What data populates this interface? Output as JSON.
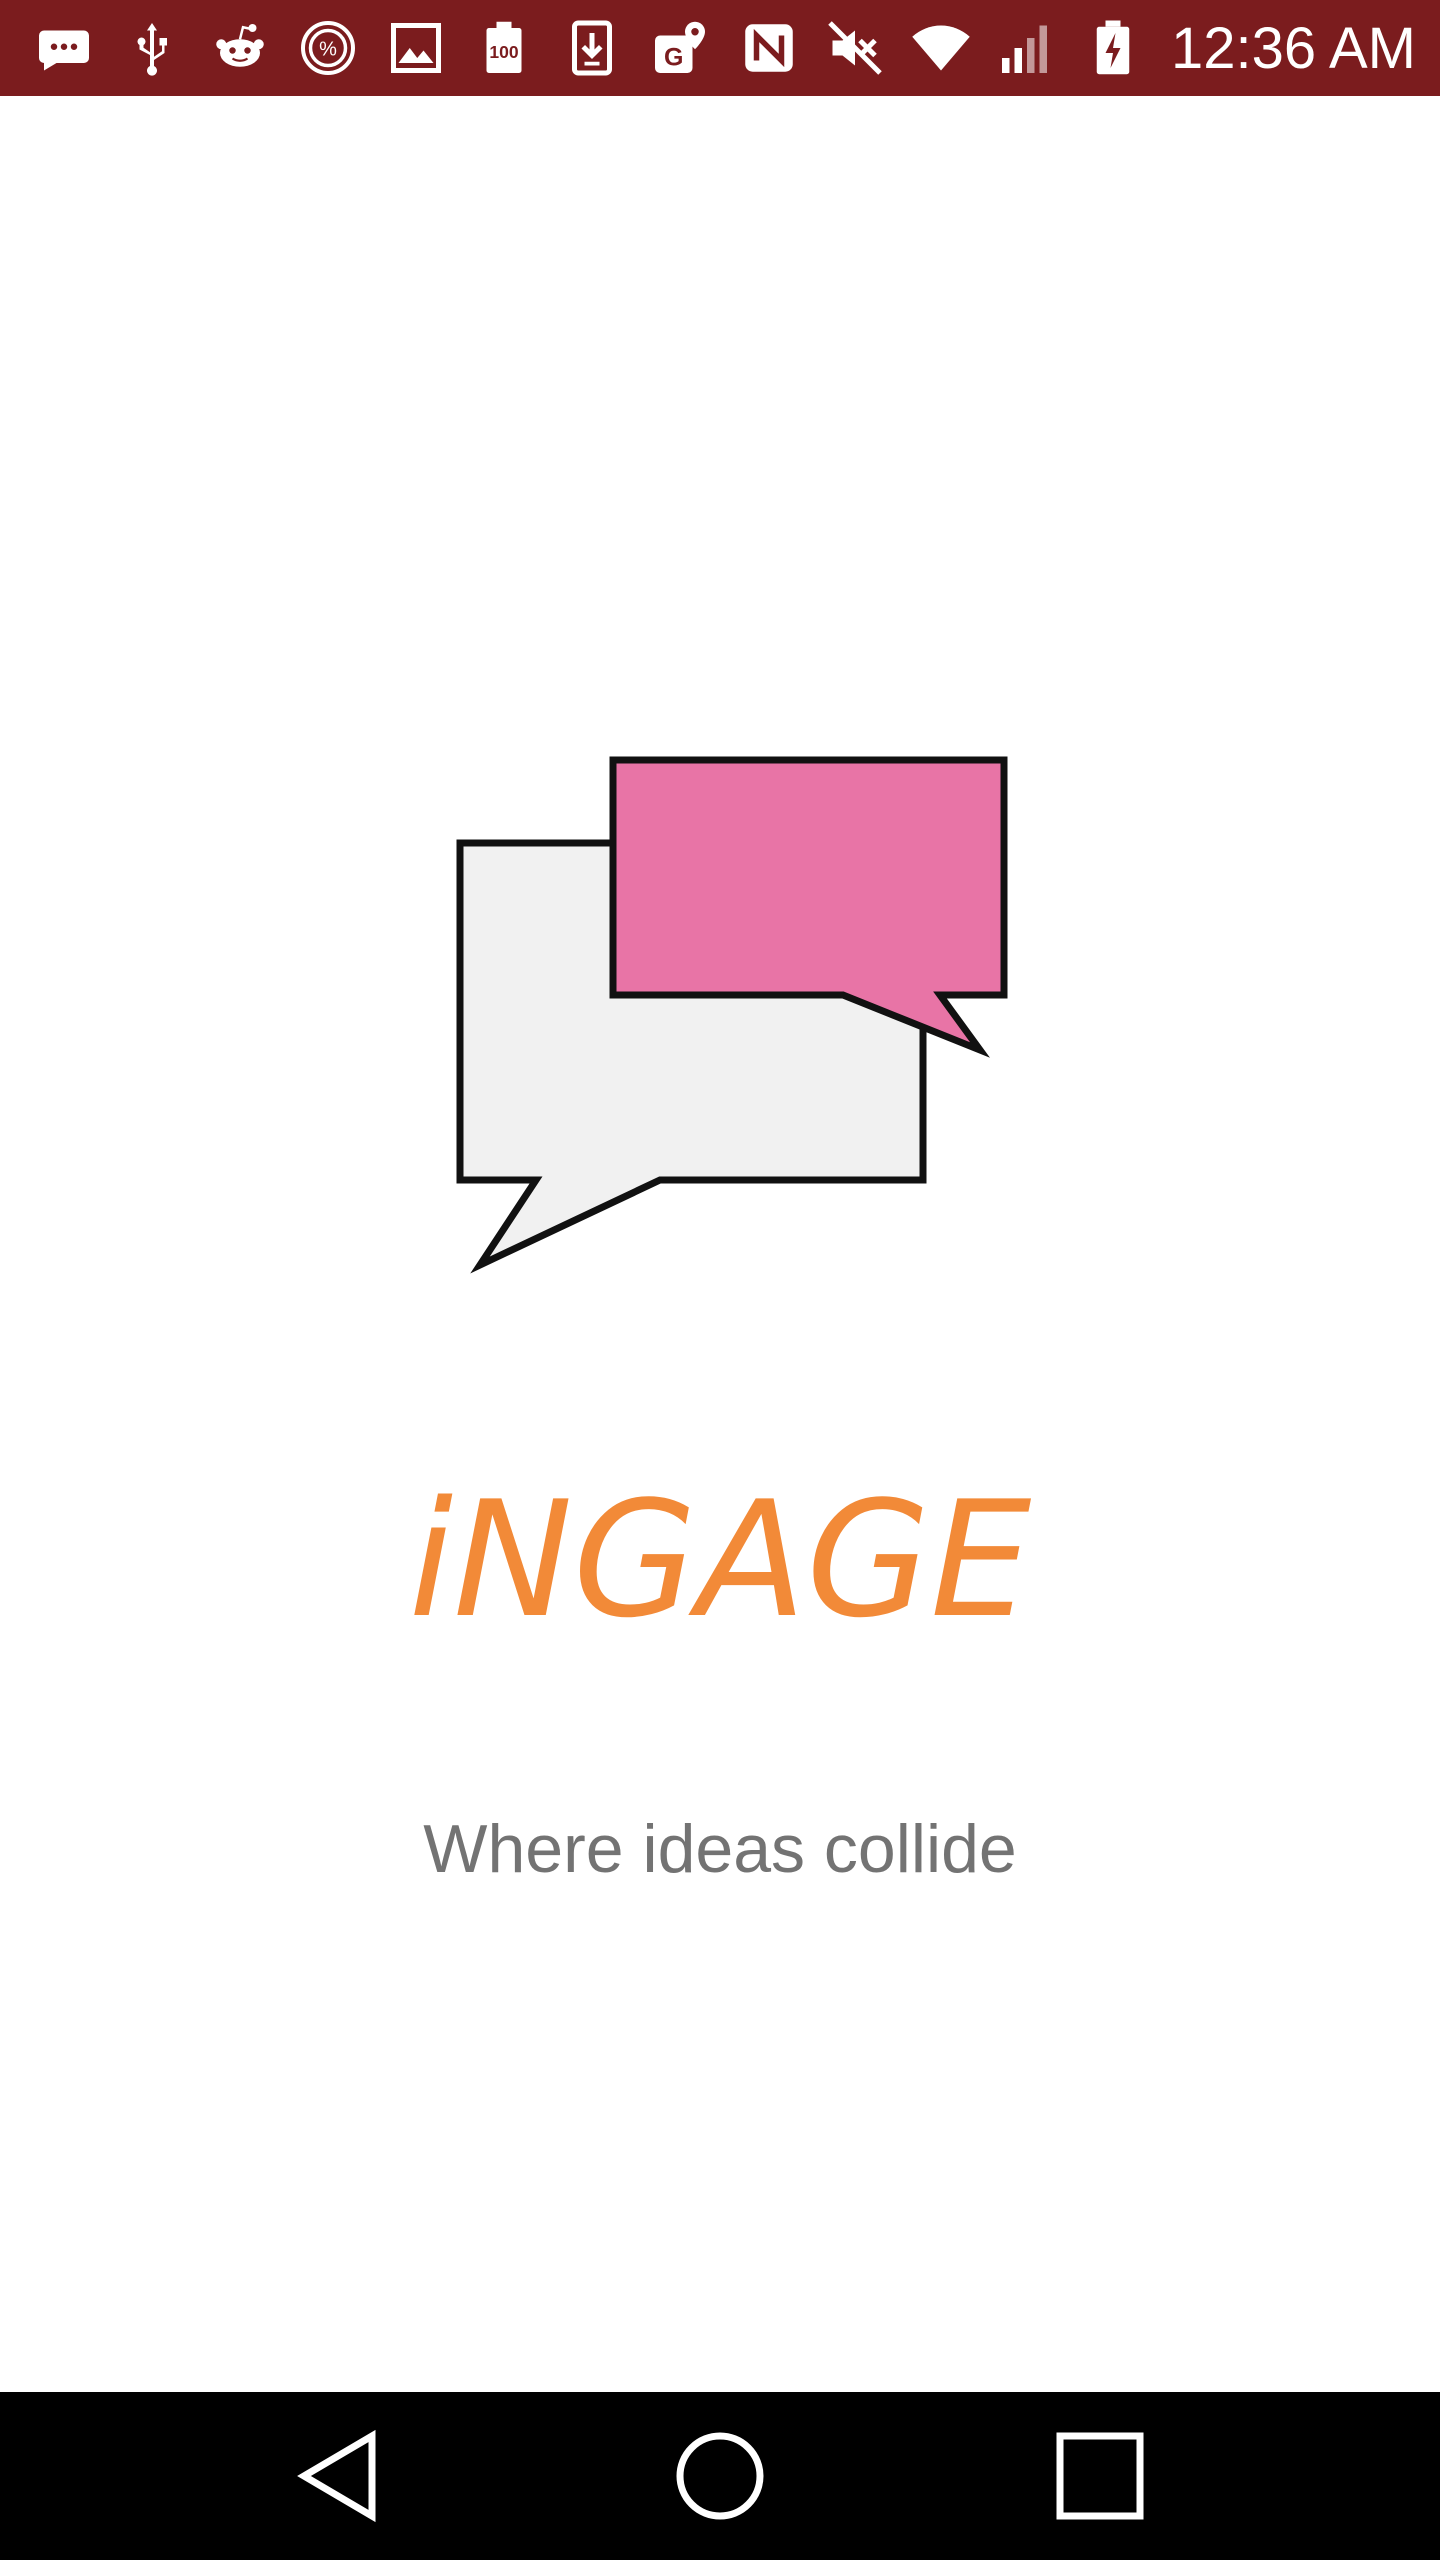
{
  "status_bar": {
    "time": "12:36 AM",
    "background_color": "#7b1c1e",
    "left_icons": [
      "message-dots-icon",
      "usb-icon",
      "reddit-icon",
      "percent-circle-icon",
      "image-icon",
      "battery-100-icon",
      "download-icon",
      "maps-icon"
    ],
    "right_icons": [
      "nfc-icon",
      "mute-icon",
      "wifi-icon",
      "signal-icon",
      "battery-charging-icon"
    ]
  },
  "splash": {
    "logo": "chat-bubbles-icon",
    "title": "iNGAGE",
    "tagline": "Where ideas collide",
    "title_color": "#f28a38",
    "tagline_color": "#737373",
    "bubble_front_color": "#e874a6",
    "bubble_back_color": "#f1f1f1"
  },
  "nav_bar": {
    "buttons": [
      "back-icon",
      "home-icon",
      "recents-icon"
    ]
  }
}
